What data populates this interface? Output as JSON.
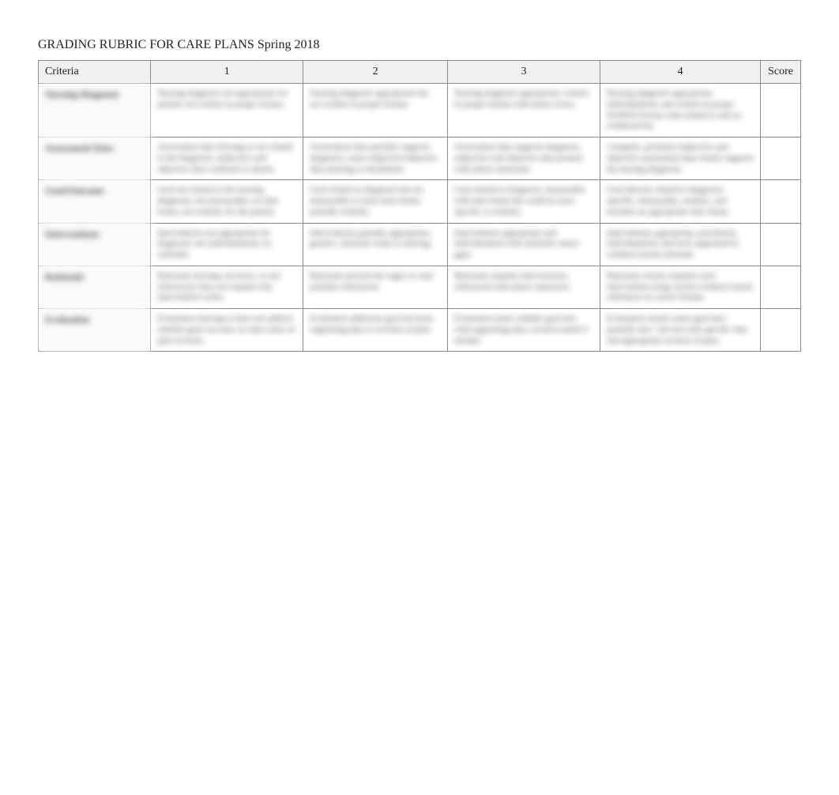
{
  "title": "GRADING RUBRIC FOR CARE PLANS Spring 2018",
  "header": {
    "criteria": "Criteria",
    "c1": "1",
    "c2": "2",
    "c3": "3",
    "c4": "4",
    "score": "Score"
  },
  "rows": [
    {
      "label": "Nursing Diagnosis",
      "c1": "Nursing diagnosis not appropriate for patient; not written in proper format.",
      "c2": "Nursing diagnosis appropriate but not written in proper format.",
      "c3": "Nursing diagnosis appropriate; written in proper format with minor errors.",
      "c4": "Nursing diagnosis appropriate, individualized, and written in proper NANDA format with related-to and as-evidenced-by.",
      "score": ""
    },
    {
      "label": "Assessment Data",
      "c1": "Assessment data missing or not related to the diagnosis; subjective and objective data confused or absent.",
      "c2": "Assessment data partially supports diagnosis; some subjective/objective data missing or mislabeled.",
      "c3": "Assessment data supports diagnosis; subjective and objective data present with minor omissions.",
      "c4": "Complete, pertinent subjective and objective assessment data clearly supports the nursing diagnosis.",
      "score": ""
    },
    {
      "label": "Goal/Outcome",
      "c1": "Goal not related to the nursing diagnosis; not measurable; no time frame; not realistic for the patient.",
      "c2": "Goal related to diagnosis but not measurable or lacks time frame; partially realistic.",
      "c3": "Goal related to diagnosis; measurable with time frame but could be more specific or realistic.",
      "c4": "Goal directly related to diagnosis; specific, measurable, realistic, and includes an appropriate time frame.",
      "score": ""
    },
    {
      "label": "Interventions",
      "c1": "Interventions not appropriate for diagnosis; not individualized; no rationale.",
      "c2": "Interventions partially appropriate; generic; rationale weak or missing.",
      "c3": "Interventions appropriate and individualized with rationale; minor gaps.",
      "c4": "Interventions appropriate, prioritized, individualized, and each supported by evidence-based rationale.",
      "score": ""
    },
    {
      "label": "Rationale",
      "c1": "Rationale missing, incorrect, or not referenced; does not explain why intervention works.",
      "c2": "Rationale present but vague or only partially referenced.",
      "c3": "Rationale explains interventions; referenced with minor omissions.",
      "c4": "Rationale clearly explains each intervention using current evidence-based references in correct format.",
      "score": ""
    },
    {
      "label": "Evaluation",
      "c1": "Evaluation missing or does not address whether goal was met; no data cited; no plan revision.",
      "c2": "Evaluation addresses goal but lacks supporting data or revision of plan.",
      "c3": "Evaluation states whether goal met with supporting data; revision noted if needed.",
      "c4": "Evaluation clearly states goal met / partially met / not met with specific data and appropriate revision of plan.",
      "score": ""
    }
  ]
}
